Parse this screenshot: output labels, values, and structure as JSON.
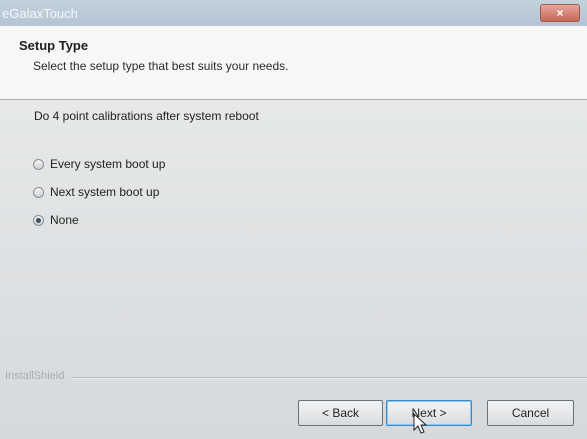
{
  "window": {
    "title": "eGalaxTouch",
    "close_label": "×"
  },
  "header": {
    "title": "Setup Type",
    "subtitle": "Select the setup type that best suits your needs."
  },
  "main": {
    "prompt": "Do 4 point calibrations after system reboot",
    "options": [
      {
        "label": "Every system boot up",
        "checked": false
      },
      {
        "label": "Next system boot up",
        "checked": false
      },
      {
        "label": "None",
        "checked": true
      }
    ]
  },
  "footer": {
    "brand": "InstallShield",
    "back_label": "< Back",
    "next_label": "Next >",
    "cancel_label": "Cancel"
  },
  "icons": {
    "close": "close-icon",
    "cursor": "mouse-pointer-icon"
  }
}
